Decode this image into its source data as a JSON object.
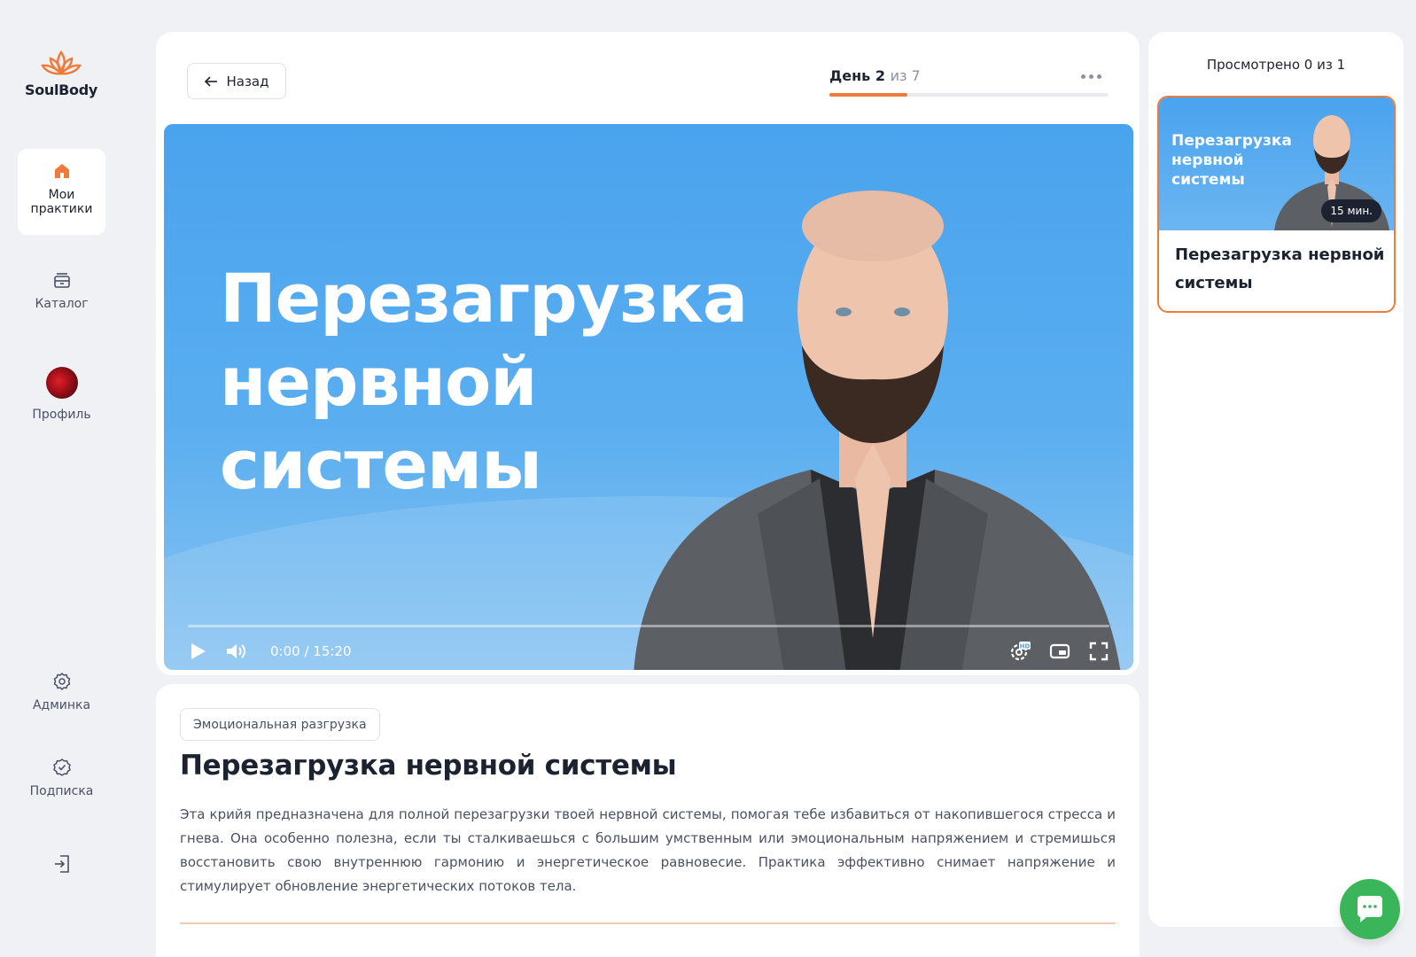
{
  "brand": {
    "name": "SoulBody",
    "accent": "#f07a3a"
  },
  "sidebar": {
    "items": [
      {
        "label": "Мои практики",
        "icon": "home-icon",
        "active": true
      },
      {
        "label": "Каталог",
        "icon": "catalog-icon",
        "active": false
      },
      {
        "label": "Профиль",
        "icon": "avatar",
        "active": false
      },
      {
        "label": "Админка",
        "icon": "gear-icon",
        "active": false
      },
      {
        "label": "Подписка",
        "icon": "badge-check-icon",
        "active": false
      }
    ],
    "logout_icon": "logout-icon"
  },
  "header": {
    "back_label": "Назад",
    "day_current": "День 2",
    "day_total": "из 7",
    "day_progress": 0.28
  },
  "video": {
    "overlay_title": "Перезагрузка нервной системы",
    "time": "0:00 / 15:20",
    "played": 0.0,
    "controls": [
      "play-icon",
      "volume-icon",
      "hd-settings-icon",
      "miniplayer-icon",
      "fullscreen-icon"
    ]
  },
  "lesson": {
    "tag": "Эмоциональная разгрузка",
    "title": "Перезагрузка нервной системы",
    "description": "Эта крийя предназначена для полной перезагрузки твоей нервной системы, помогая тебе избавиться от накопившегося стресса и гнева. Она особенно полезна, если ты сталкиваешься с большим умственным или эмоциональным напряжением и стремишься восстановить свою внутреннюю гармонию и энергетическое равновесие. Практика эффективно снимает напряжение и стимулирует обновление энергетических потоков тела."
  },
  "playlist": {
    "watched": "Просмотрено 0 из 1",
    "items": [
      {
        "thumb_title": "Перезагрузка нервной системы",
        "duration": "15 мин.",
        "title": "Перезагрузка нервной системы",
        "selected": true
      }
    ]
  },
  "chat": {
    "icon": "chat-icon",
    "color": "#3bb55a"
  }
}
